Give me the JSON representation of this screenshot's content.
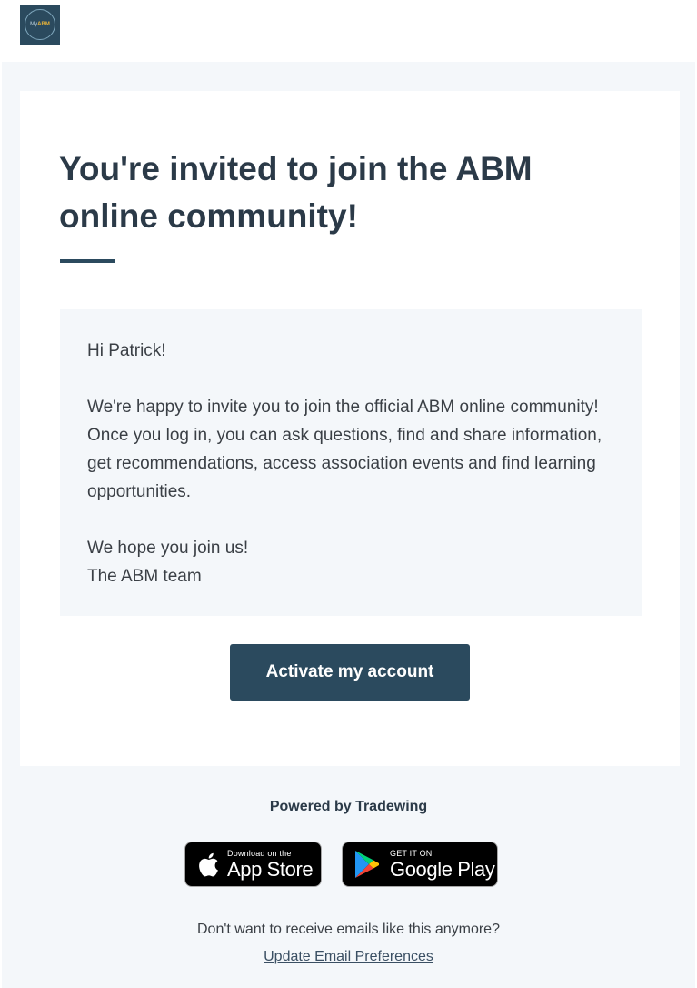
{
  "header": {
    "logo_text_prefix": "My",
    "logo_text_brand": "ABM"
  },
  "email": {
    "heading": "You're invited to join the ABM online community!",
    "greeting": "Hi Patrick!",
    "body": "We're happy to invite you to join the official ABM online community! Once you log in, you can ask questions, find and share information, get recommendations, access association events and find learning opportunities.",
    "closing_line": "We hope you join us!",
    "signature": "The ABM team",
    "cta_label": "Activate my account"
  },
  "footer": {
    "powered_by": "Powered by Tradewing",
    "app_store": {
      "small": "Download on the",
      "big": "App Store",
      "icon": "apple-icon"
    },
    "google_play": {
      "small": "GET IT ON",
      "big": "Google Play",
      "icon": "google-play-icon"
    },
    "unsubscribe_text": "Don't want to receive emails like this anymore?",
    "preferences_link": "Update Email Preferences"
  },
  "colors": {
    "brand": "#2b4a5e",
    "heading": "#2b3a48",
    "body_text": "#3a3f45",
    "page_background": "#f4f7fa"
  }
}
